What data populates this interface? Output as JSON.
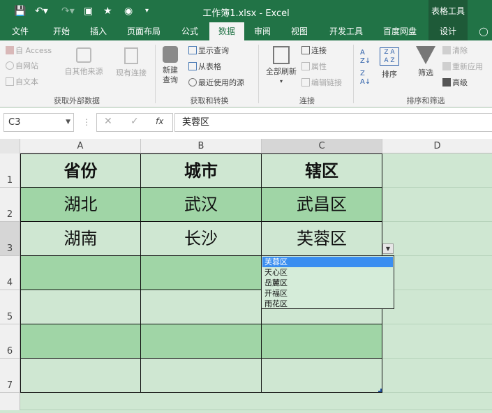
{
  "title_bar": {
    "doc_title": "工作簿1.xlsx - Excel",
    "contextual_header": "表格工具"
  },
  "tabs": [
    {
      "label": "文件"
    },
    {
      "label": "开始"
    },
    {
      "label": "插入"
    },
    {
      "label": "页面布局"
    },
    {
      "label": "公式"
    },
    {
      "label": "数据"
    },
    {
      "label": "审阅"
    },
    {
      "label": "视图"
    },
    {
      "label": "开发工具"
    },
    {
      "label": "百度网盘"
    },
    {
      "label": "设计"
    }
  ],
  "active_tab": "数据",
  "ribbon": {
    "get_external": {
      "access": "自 Access",
      "web": "自网站",
      "text": "自文本",
      "other": "自其他来源",
      "existing": "现有连接",
      "label": "获取外部数据"
    },
    "get_transform": {
      "new_query_1": "新建",
      "new_query_2": "查询",
      "show_queries": "显示查询",
      "from_table": "从表格",
      "recent_sources": "最近使用的源",
      "label": "获取和转换"
    },
    "connections": {
      "refresh_all": "全部刷新",
      "connections": "连接",
      "properties": "属性",
      "edit_links": "编辑链接",
      "label": "连接"
    },
    "sort_filter": {
      "sort": "排序",
      "filter": "筛选",
      "clear": "清除",
      "reapply": "重新应用",
      "advanced": "高级",
      "label": "排序和筛选"
    }
  },
  "formula_bar": {
    "name_box": "C3",
    "formula": "芙蓉区",
    "fx": "fx"
  },
  "columns": [
    "A",
    "B",
    "C",
    "D"
  ],
  "rows": [
    "1",
    "2",
    "3",
    "4",
    "5",
    "6",
    "7"
  ],
  "cells": {
    "A1": "省份",
    "B1": "城市",
    "C1": "辖区",
    "A2": "湖北",
    "B2": "武汉",
    "C2": "武昌区",
    "A3": "湖南",
    "B3": "长沙",
    "C3": "芙蓉区"
  },
  "dropdown": {
    "options": [
      "芙蓉区",
      "天心区",
      "岳麓区",
      "开福区",
      "雨花区"
    ],
    "selected": "芙蓉区"
  },
  "colors": {
    "excel_green": "#217346",
    "band_dark": "#a0d5a6",
    "band_light": "#cfe7d2",
    "selection_blue": "#3a8ef0"
  }
}
